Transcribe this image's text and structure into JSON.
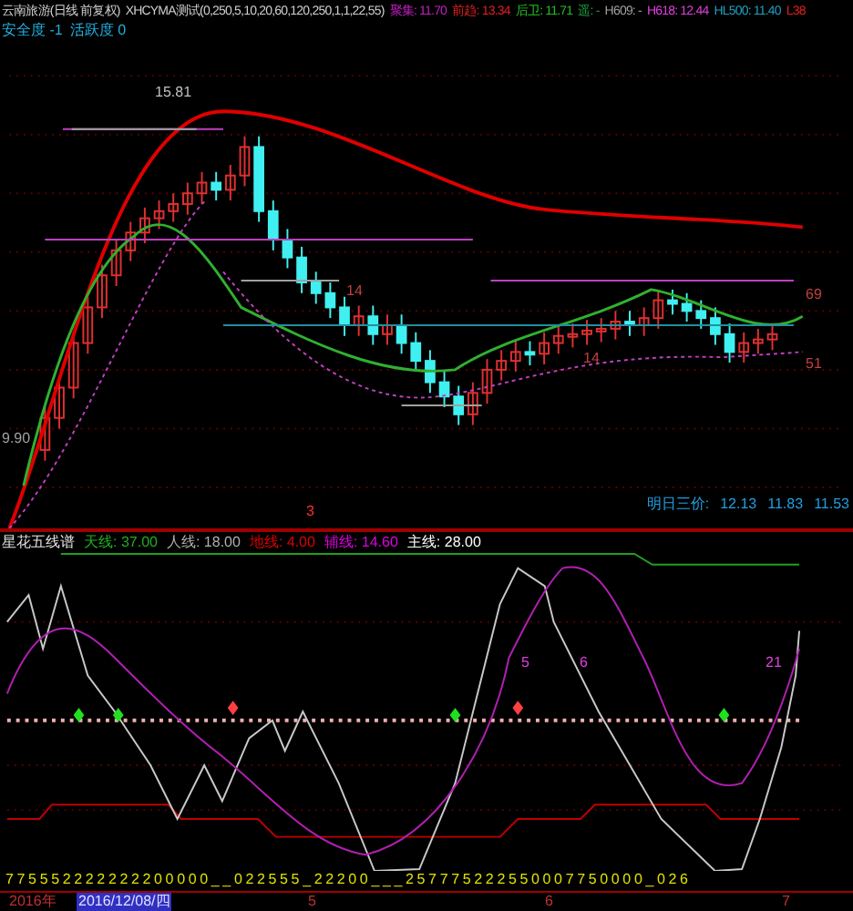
{
  "header": {
    "title": "云南旅游(日线 前复权)",
    "indicator": "XHCYMA测试(0,250,5,10,20,60,120,250,1,1,22,55)",
    "values": [
      {
        "label": "聚集:",
        "value": "11.70",
        "color": "#c020c0"
      },
      {
        "label": "前趋:",
        "value": "13.34",
        "color": "#e02020"
      },
      {
        "label": "后卫:",
        "value": "11.71",
        "color": "#20c020"
      },
      {
        "label": "遥:",
        "value": "-",
        "color": "#20a040"
      },
      {
        "label": "H609:",
        "value": "-",
        "color": "#a0a0a0"
      },
      {
        "label": "H618:",
        "value": "12.44",
        "color": "#e040e0"
      },
      {
        "label": "HL500:",
        "value": "11.40",
        "color": "#20a0c0"
      },
      {
        "label": "L38",
        "color": "#e02020"
      }
    ]
  },
  "status": [
    {
      "label": "安全度",
      "value": "-1"
    },
    {
      "label": "活跃度",
      "value": "0"
    }
  ],
  "upper_panel": {
    "labels": [
      "15.81",
      "9.90",
      "14",
      "14",
      "69",
      "51",
      "3"
    ],
    "forecast_label": "明日三价:",
    "forecast_values": [
      "12.13",
      "11.83",
      "11.53"
    ]
  },
  "lower_panel": {
    "title": "星花五线谱",
    "lines": [
      {
        "label": "天线:",
        "value": "37.00",
        "color": "#20b020"
      },
      {
        "label": "人线:",
        "value": "18.00",
        "color": "#b0b0b0"
      },
      {
        "label": "地线:",
        "value": "4.00",
        "color": "#e00000"
      },
      {
        "label": "辅线:",
        "value": "14.60",
        "color": "#e000e0"
      },
      {
        "label": "主线:",
        "value": "28.00",
        "color": "#ffffff"
      }
    ],
    "marks": [
      "5",
      "6",
      "21"
    ],
    "digits": "7 7 5 5 5 2 2 2 2 2 2 2 2 0 0 0 0 0 _ _ 0 2 2 5 5 5 _ 2 2 2 0 0 _ _ _ 2 5 7 7 7 5 2 2 2 5 5 0 0 0 7 7 5 0 0 0 0 _ 0 2 6"
  },
  "date_axis": [
    {
      "text": "2016年",
      "selected": false
    },
    {
      "text": "2016/12/08/四",
      "selected": true
    },
    {
      "text": "5",
      "selected": false
    },
    {
      "text": "6",
      "selected": false
    },
    {
      "text": "7",
      "selected": false
    }
  ]
}
